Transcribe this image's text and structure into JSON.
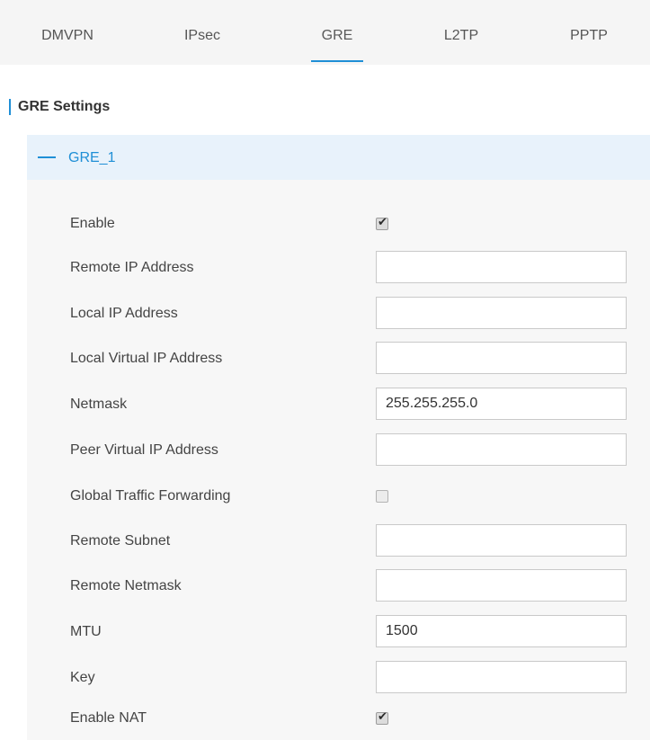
{
  "tabs": [
    {
      "label": "DMVPN",
      "active": false
    },
    {
      "label": "IPsec",
      "active": false
    },
    {
      "label": "GRE",
      "active": true
    },
    {
      "label": "L2TP",
      "active": false
    },
    {
      "label": "PPTP",
      "active": false
    }
  ],
  "section_title": "GRE Settings",
  "panel": {
    "header_label": "GRE_1",
    "collapse_icon": "minus-icon"
  },
  "form": {
    "enable": {
      "label": "Enable",
      "checked": true
    },
    "remote_ip": {
      "label": "Remote IP Address",
      "value": ""
    },
    "local_ip": {
      "label": "Local IP Address",
      "value": ""
    },
    "local_virtual_ip": {
      "label": "Local Virtual IP Address",
      "value": ""
    },
    "netmask": {
      "label": "Netmask",
      "value": "255.255.255.0"
    },
    "peer_virtual_ip": {
      "label": "Peer Virtual IP Address",
      "value": ""
    },
    "global_traffic_forwarding": {
      "label": "Global Traffic Forwarding",
      "checked": false
    },
    "remote_subnet": {
      "label": "Remote Subnet",
      "value": ""
    },
    "remote_netmask": {
      "label": "Remote Netmask",
      "value": ""
    },
    "mtu": {
      "label": "MTU",
      "value": "1500"
    },
    "key": {
      "label": "Key",
      "value": ""
    },
    "enable_nat": {
      "label": "Enable NAT",
      "checked": true
    }
  },
  "colors": {
    "accent": "#1f8fd6",
    "tab_bar_bg": "#f5f5f5",
    "panel_header_bg": "#e8f2fb",
    "panel_bg": "#f7f7f7"
  }
}
